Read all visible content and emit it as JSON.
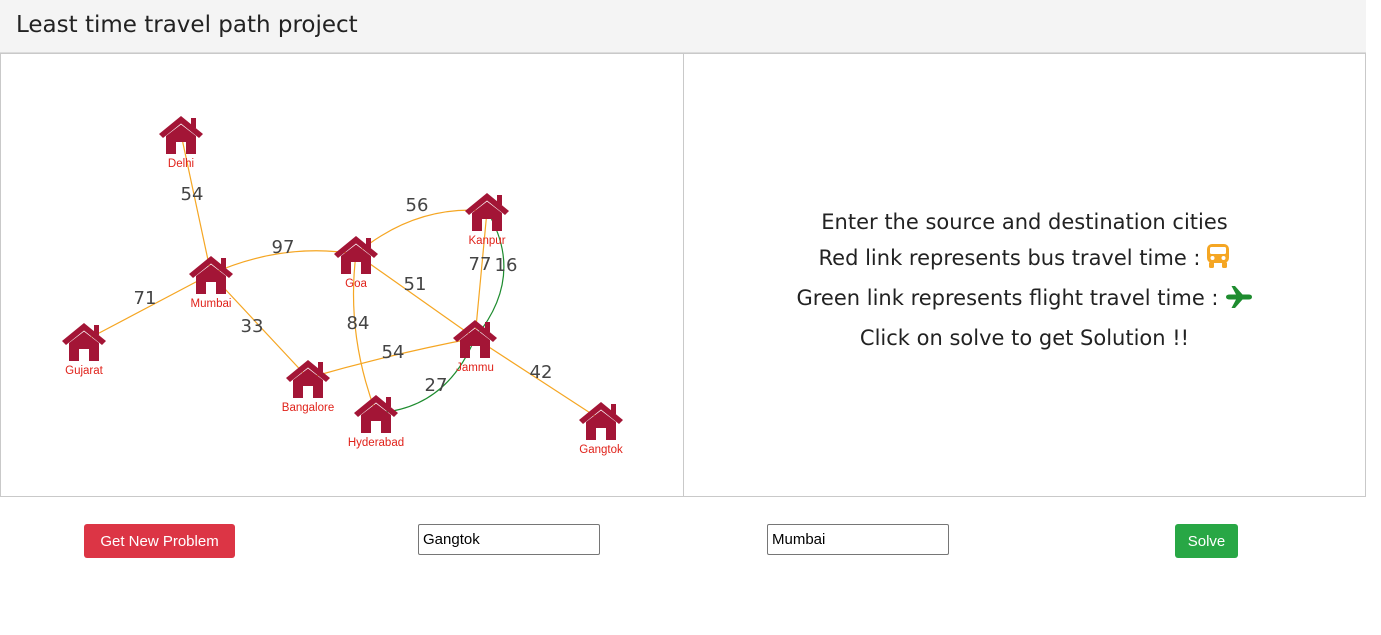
{
  "header": {
    "title": "Least time travel path project"
  },
  "graph": {
    "colors": {
      "bus": "#f5a623",
      "flight": "#1e8c2f",
      "house": "#a31536",
      "label": "#e0221a"
    },
    "cities": [
      "Delhi",
      "Kanpur",
      "Goa",
      "Mumbai",
      "Gujarat",
      "Jammu",
      "Bangalore",
      "Hyderabad",
      "Gangtok"
    ],
    "edges": [
      {
        "from": "Delhi",
        "to": "Mumbai",
        "mode": "bus",
        "weight": "54"
      },
      {
        "from": "Mumbai",
        "to": "Goa",
        "mode": "bus",
        "weight": "97"
      },
      {
        "from": "Mumbai",
        "to": "Gujarat",
        "mode": "bus",
        "weight": "71"
      },
      {
        "from": "Mumbai",
        "to": "Bangalore",
        "mode": "bus",
        "weight": "33"
      },
      {
        "from": "Goa",
        "to": "Kanpur",
        "mode": "bus",
        "weight": "56"
      },
      {
        "from": "Goa",
        "to": "Jammu",
        "mode": "bus",
        "weight": "51"
      },
      {
        "from": "Goa",
        "to": "Hyderabad",
        "mode": "bus",
        "weight": "84"
      },
      {
        "from": "Kanpur",
        "to": "Jammu",
        "mode": "bus",
        "weight": "77"
      },
      {
        "from": "Kanpur",
        "to": "Jammu",
        "mode": "flight",
        "weight": "16"
      },
      {
        "from": "Bangalore",
        "to": "Jammu",
        "mode": "bus",
        "weight": "54"
      },
      {
        "from": "Hyderabad",
        "to": "Jammu",
        "mode": "flight",
        "weight": "27"
      },
      {
        "from": "Jammu",
        "to": "Gangtok",
        "mode": "bus",
        "weight": "42"
      }
    ]
  },
  "info": {
    "line1": "Enter the source and destination cities",
    "line2": "Red link represents bus travel time :",
    "line2_icon": "bus-icon",
    "line3": "Green link represents flight travel time :",
    "line3_icon": "airplane-icon",
    "line4": "Click on solve to get Solution !!"
  },
  "controls": {
    "new_problem_label": "Get New Problem",
    "source_value": "Gangtok",
    "destination_value": "Mumbai",
    "solve_label": "Solve"
  }
}
